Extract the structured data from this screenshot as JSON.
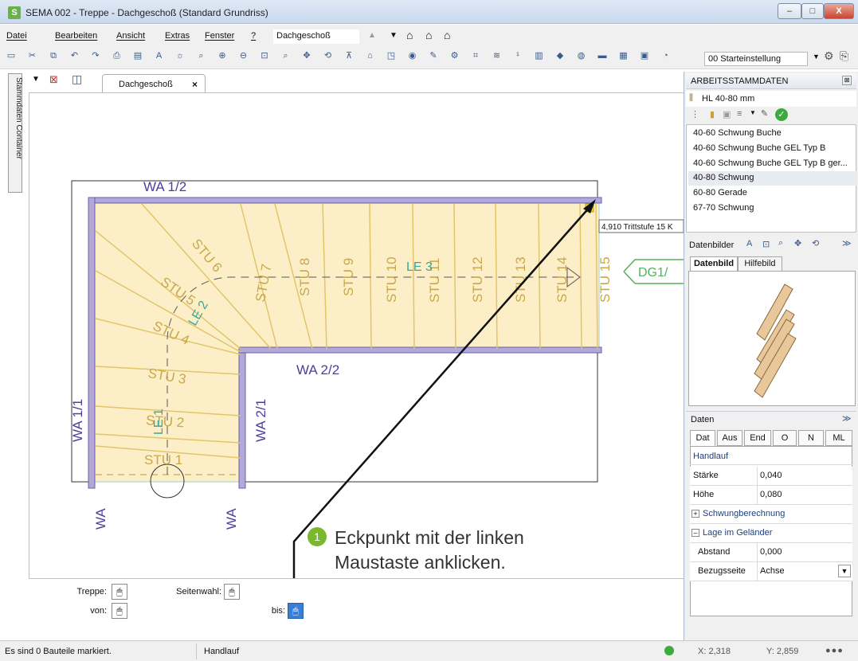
{
  "window": {
    "app_icon": "S",
    "title": "SEMA  002 - Treppe  - Dachgeschoß (Standard Grundriss)",
    "minimize": "–",
    "maximize": "□",
    "close": "X"
  },
  "menu": {
    "items": [
      "Datei",
      "Bearbeiten",
      "Ansicht",
      "Extras",
      "Fenster",
      "?"
    ],
    "floor_value": "Dachgeschoß"
  },
  "toolbar": {
    "icons": [
      "open-icon",
      "cut-icon",
      "copy-icon",
      "undo-icon",
      "redo-icon",
      "print-icon",
      "print-preview-icon",
      "text-style-icon",
      "light-icon",
      "zoom-icon",
      "zoom-in-icon",
      "zoom-out-icon",
      "zoom-window-icon",
      "zoom-all-icon",
      "pan-icon",
      "rotate-icon",
      "dimension-icon",
      "snap-icon",
      "layer-icon",
      "view-icon",
      "paint-icon",
      "settings-icon",
      "measure-icon",
      "area-icon",
      "text-icon",
      "stair-icon",
      "color-icon",
      "render-icon",
      "material-icon",
      "grid-icon",
      "camera-icon",
      "preset-icon"
    ],
    "preset_value": "00 Starteinstellung"
  },
  "sidebar": {
    "container_label": "Stammdaten Container"
  },
  "document_tab": {
    "label": "Dachgeschoß",
    "close": "×"
  },
  "plan": {
    "wall_labels": {
      "top": "WA 1/2",
      "inner_horizontal": "WA 2/2",
      "left": "WA 1/1",
      "inner_vertical": "WA 2/1",
      "bottom_left": "WA",
      "bottom_right": "WA"
    },
    "steps": [
      "STU 1",
      "STU 2",
      "STU 3",
      "STU 4",
      "STU 5",
      "STU 6",
      "STU 7",
      "STU 8",
      "STU 9",
      "STU 10",
      "STU 11",
      "STU 12",
      "STU 13",
      "STU 14",
      "STU 15"
    ],
    "run_labels": [
      "LE 1",
      "LE 2",
      "LE 3"
    ],
    "level_marker": "DG1/",
    "tooltip": "4,910 Trittstufe 15 K",
    "colors": {
      "step_fill": "#fcefc7",
      "step_line": "#e2c46a",
      "step_text": "#c8a84a",
      "wall_text": "#4a3f9c",
      "run_text": "#3aa6a0"
    }
  },
  "callout": {
    "number": "1",
    "text": "Eckpunkt mit der linken\nMaustaste anklicken."
  },
  "options": {
    "treppe_label": "Treppe:",
    "seitenwahl_label": "Seitenwahl:",
    "von_label": "von:",
    "bis_label": "bis:",
    "mouse_glyph": "🖱"
  },
  "panel": {
    "title": "ARBEITSSTAMMDATEN",
    "current_item": "HL 40-80 mm",
    "list": [
      "40-60 Schwung Buche",
      "40-60 Schwung Buche GEL Typ B",
      "40-60 Schwung Buche GEL Typ B ger...",
      "40-80 Schwung",
      "60-80 Gerade",
      "67-70 Schwung"
    ],
    "selected_index": 3,
    "datenbilder_label": "Datenbilder",
    "image_tabs": [
      "Datenbild",
      "Hilfebild"
    ],
    "daten_label": "Daten",
    "data_tabs": [
      "Dat",
      "Aus",
      "End",
      "O",
      "N",
      "ML"
    ],
    "section_handlauf": "Handlauf",
    "properties": [
      {
        "name": "Stärke",
        "value": "0,040"
      },
      {
        "name": "Höhe",
        "value": "0,080"
      }
    ],
    "group_schwung": "Schwungberechnung",
    "group_lage": "Lage im Geländer",
    "lage_properties": [
      {
        "name": "Abstand",
        "value": "0,000"
      },
      {
        "name": "Bezugsseite",
        "value": "Achse"
      }
    ],
    "expand": "+",
    "collapse": "–"
  },
  "status": {
    "message": "Es sind 0 Bauteile markiert.",
    "mode": "Handlauf",
    "x_readout": "X: 2,318",
    "y_readout": "Y: 2,859"
  }
}
